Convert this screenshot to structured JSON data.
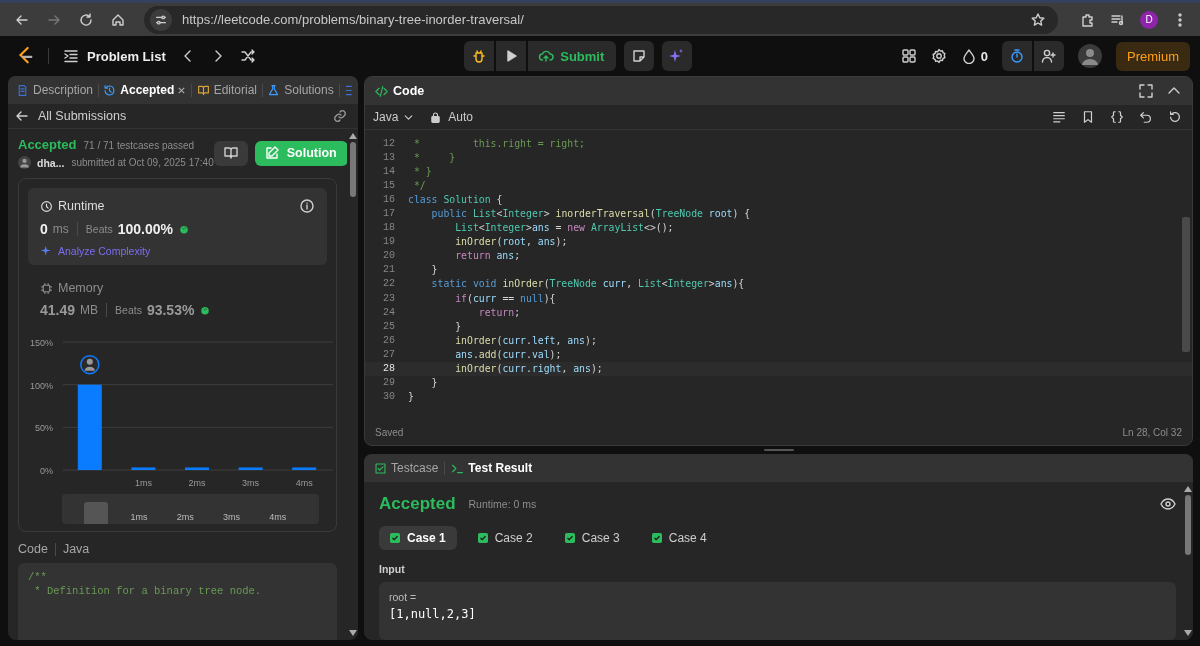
{
  "browser": {
    "url": "https://leetcode.com/problems/binary-tree-inorder-traversal/",
    "profile_initial": "D"
  },
  "nav": {
    "problem_list": "Problem List",
    "submit": "Submit",
    "streak": "0",
    "premium": "Premium"
  },
  "left": {
    "tabs": [
      {
        "label": "Description",
        "selected": false,
        "closable": false
      },
      {
        "label": "Accepted",
        "selected": true,
        "closable": true
      },
      {
        "label": "Editorial",
        "selected": false,
        "closable": false
      },
      {
        "label": "Solutions",
        "selected": false,
        "closable": false
      }
    ],
    "back_link": "All Submissions",
    "status": "Accepted",
    "testcases": "71 / 71 testcases passed",
    "user": "dha...",
    "submitted": "submitted at Oct 09, 2025 17:40",
    "solution_button": "Solution",
    "runtime": {
      "title": "Runtime",
      "value": "0",
      "unit": "ms",
      "beats_label": "Beats",
      "beats": "100.00%",
      "analyze": "Analyze Complexity"
    },
    "memory": {
      "title": "Memory",
      "value": "41.49",
      "unit": "MB",
      "beats_label": "Beats",
      "beats": "93.53%"
    },
    "chart_data": {
      "type": "bar",
      "categories": [
        null,
        "1ms",
        "2ms",
        "3ms",
        "4ms"
      ],
      "values": [
        100,
        3,
        3,
        3,
        3
      ],
      "ylim": [
        0,
        150
      ],
      "yticks": [
        {
          "value": 0,
          "label": "0%"
        },
        {
          "value": 50,
          "label": "50%"
        },
        {
          "value": 100,
          "label": "100%"
        },
        {
          "value": 150,
          "label": "150%"
        }
      ]
    },
    "navigator": {
      "labels": [
        "1ms",
        "2ms",
        "3ms",
        "4ms"
      ]
    },
    "code_label": "Code",
    "code_lang": "Java",
    "code_preview": [
      "/**",
      " * Definition for a binary tree node."
    ]
  },
  "editor": {
    "title": "Code",
    "language": "Java",
    "mode": "Auto",
    "status": "Saved",
    "cursor": "Ln 28, Col 32",
    "lines": [
      {
        "n": "12",
        "current": false,
        "tokens": [
          {
            "kind": "comment",
            "text": " *         this.right = right;"
          }
        ]
      },
      {
        "n": "13",
        "current": false,
        "tokens": [
          {
            "kind": "comment",
            "text": " *     }"
          }
        ]
      },
      {
        "n": "14",
        "current": false,
        "tokens": [
          {
            "kind": "comment",
            "text": " * }"
          }
        ]
      },
      {
        "n": "15",
        "current": false,
        "tokens": [
          {
            "kind": "comment",
            "text": " */"
          }
        ]
      },
      {
        "n": "16",
        "current": false,
        "tokens": [
          {
            "kind": "keyword",
            "text": "class"
          },
          {
            "kind": "type",
            "text": " Solution"
          },
          {
            "kind": "plain",
            "text": " {"
          }
        ]
      },
      {
        "n": "17",
        "current": false,
        "tokens": [
          {
            "kind": "keyword",
            "text": "    public"
          },
          {
            "kind": "type",
            "text": " List"
          },
          {
            "kind": "plain",
            "text": "<"
          },
          {
            "kind": "type",
            "text": "Integer"
          },
          {
            "kind": "plain",
            "text": "> "
          },
          {
            "kind": "fn",
            "text": "inorderTraversal"
          },
          {
            "kind": "plain",
            "text": "("
          },
          {
            "kind": "type",
            "text": "TreeNode"
          },
          {
            "kind": "var",
            "text": " root"
          },
          {
            "kind": "plain",
            "text": ") {"
          }
        ]
      },
      {
        "n": "18",
        "current": false,
        "tokens": [
          {
            "kind": "type",
            "text": "        List"
          },
          {
            "kind": "plain",
            "text": "<"
          },
          {
            "kind": "type",
            "text": "Integer"
          },
          {
            "kind": "plain",
            "text": ">"
          },
          {
            "kind": "var",
            "text": "ans"
          },
          {
            "kind": "plain",
            "text": " = "
          },
          {
            "kind": "control",
            "text": "new"
          },
          {
            "kind": "type",
            "text": " ArrayList"
          },
          {
            "kind": "plain",
            "text": "<>();"
          }
        ]
      },
      {
        "n": "19",
        "current": false,
        "tokens": [
          {
            "kind": "fn",
            "text": "        inOrder"
          },
          {
            "kind": "plain",
            "text": "("
          },
          {
            "kind": "var",
            "text": "root"
          },
          {
            "kind": "plain",
            "text": ", "
          },
          {
            "kind": "var",
            "text": "ans"
          },
          {
            "kind": "plain",
            "text": ");"
          }
        ]
      },
      {
        "n": "20",
        "current": false,
        "tokens": [
          {
            "kind": "control",
            "text": "        return"
          },
          {
            "kind": "var",
            "text": " ans"
          },
          {
            "kind": "plain",
            "text": ";"
          }
        ]
      },
      {
        "n": "21",
        "current": false,
        "tokens": [
          {
            "kind": "plain",
            "text": "    }"
          }
        ]
      },
      {
        "n": "22",
        "current": false,
        "tokens": [
          {
            "kind": "keyword",
            "text": "    static void"
          },
          {
            "kind": "fn",
            "text": " inOrder"
          },
          {
            "kind": "plain",
            "text": "("
          },
          {
            "kind": "type",
            "text": "TreeNode"
          },
          {
            "kind": "var",
            "text": " curr"
          },
          {
            "kind": "plain",
            "text": ", "
          },
          {
            "kind": "type",
            "text": "List"
          },
          {
            "kind": "plain",
            "text": "<"
          },
          {
            "kind": "type",
            "text": "Integer"
          },
          {
            "kind": "plain",
            "text": ">"
          },
          {
            "kind": "var",
            "text": "ans"
          },
          {
            "kind": "plain",
            "text": "){"
          }
        ]
      },
      {
        "n": "23",
        "current": false,
        "tokens": [
          {
            "kind": "control",
            "text": "        if"
          },
          {
            "kind": "plain",
            "text": "("
          },
          {
            "kind": "var",
            "text": "curr"
          },
          {
            "kind": "plain",
            "text": " == "
          },
          {
            "kind": "keyword",
            "text": "null"
          },
          {
            "kind": "plain",
            "text": "){"
          }
        ]
      },
      {
        "n": "24",
        "current": false,
        "tokens": [
          {
            "kind": "control",
            "text": "            return"
          },
          {
            "kind": "plain",
            "text": ";"
          }
        ]
      },
      {
        "n": "25",
        "current": false,
        "tokens": [
          {
            "kind": "plain",
            "text": "        }"
          }
        ]
      },
      {
        "n": "26",
        "current": false,
        "tokens": [
          {
            "kind": "fn",
            "text": "        inOrder"
          },
          {
            "kind": "plain",
            "text": "("
          },
          {
            "kind": "var",
            "text": "curr"
          },
          {
            "kind": "plain",
            "text": "."
          },
          {
            "kind": "var",
            "text": "left"
          },
          {
            "kind": "plain",
            "text": ", "
          },
          {
            "kind": "var",
            "text": "ans"
          },
          {
            "kind": "plain",
            "text": ");"
          }
        ]
      },
      {
        "n": "27",
        "current": false,
        "tokens": [
          {
            "kind": "var",
            "text": "        ans"
          },
          {
            "kind": "plain",
            "text": "."
          },
          {
            "kind": "fn",
            "text": "add"
          },
          {
            "kind": "plain",
            "text": "("
          },
          {
            "kind": "var",
            "text": "curr"
          },
          {
            "kind": "plain",
            "text": "."
          },
          {
            "kind": "var",
            "text": "val"
          },
          {
            "kind": "plain",
            "text": ");"
          }
        ]
      },
      {
        "n": "28",
        "current": true,
        "tokens": [
          {
            "kind": "fn",
            "text": "        inOrder"
          },
          {
            "kind": "plain",
            "text": "("
          },
          {
            "kind": "var",
            "text": "curr"
          },
          {
            "kind": "plain",
            "text": "."
          },
          {
            "kind": "var",
            "text": "right"
          },
          {
            "kind": "plain",
            "text": ", "
          },
          {
            "kind": "var",
            "text": "ans"
          },
          {
            "kind": "plain",
            "text": ");"
          }
        ]
      },
      {
        "n": "29",
        "current": false,
        "tokens": [
          {
            "kind": "plain",
            "text": "    }"
          }
        ]
      },
      {
        "n": "30",
        "current": false,
        "tokens": [
          {
            "kind": "plain",
            "text": "}"
          }
        ]
      }
    ]
  },
  "results": {
    "tabs": [
      {
        "label": "Testcase",
        "selected": false
      },
      {
        "label": "Test Result",
        "selected": true
      }
    ],
    "verdict": "Accepted",
    "runtime": "Runtime: 0 ms",
    "cases": [
      {
        "label": "Case 1",
        "selected": true,
        "passed": true
      },
      {
        "label": "Case 2",
        "selected": false,
        "passed": true
      },
      {
        "label": "Case 3",
        "selected": false,
        "passed": true
      },
      {
        "label": "Case 4",
        "selected": false,
        "passed": true
      }
    ],
    "input_label": "Input",
    "param": "root =",
    "value": "[1,null,2,3]"
  }
}
